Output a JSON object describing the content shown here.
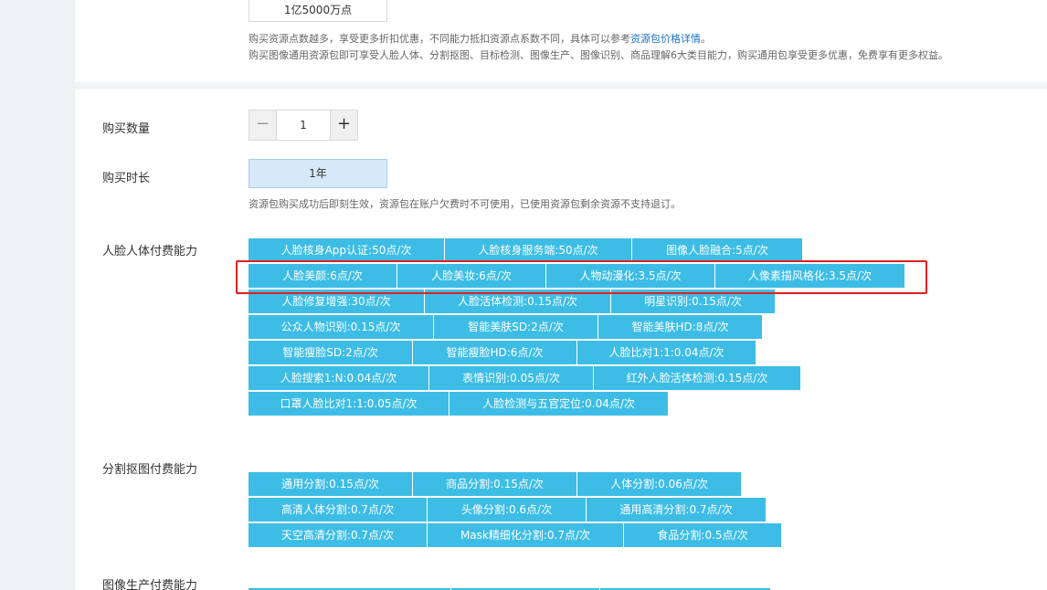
{
  "top": {
    "points_value": "1亿5000万点",
    "note_line1_before": "购买资源点数越多，享受更多折扣优惠，不同能力抵扣资源点系数不同，具体可以参考",
    "note_line1_link": "资源包价格详情",
    "note_line1_after": "。",
    "note_line2": "购买图像通用资源包即可享受人脸人体、分割抠图、目标检测、图像生产、图像识别、商品理解6大类目能力，购买通用包享受更多优惠，免费享有更多权益。"
  },
  "quantity": {
    "label": "购买数量",
    "minus": "−",
    "value": "1",
    "plus": "+"
  },
  "duration": {
    "label": "购买时长",
    "value": "1年",
    "note": "资源包购买成功后即刻生效，资源包在账户欠费时不可使用，已使用资源包剩余资源不支持退订。"
  },
  "face_section": {
    "label": "人脸人体付费能力",
    "tags": [
      "人脸核身App认证:50点/次",
      "人脸核身服务端:50点/次",
      "图像人脸融合:5点/次",
      "人脸美颜:6点/次",
      "人脸美妆:6点/次",
      "人物动漫化:3.5点/次",
      "人像素描风格化:3.5点/次",
      "人脸修复增强:30点/次",
      "人脸活体检测:0.15点/次",
      "明星识别:0.15点/次",
      "公众人物识别:0.15点/次",
      "智能美肤SD:2点/次",
      "智能美肤HD:8点/次",
      "智能瘦脸SD:2点/次",
      "智能瘦脸HD:6点/次",
      "人脸比对1:1:0.04点/次",
      "人脸搜索1:N:0.04点/次",
      "表情识别:0.05点/次",
      "红外人脸活体检测:0.15点/次",
      "口罩人脸比对1:1:0.05点/次",
      "人脸检测与五官定位:0.04点/次"
    ]
  },
  "seg_section": {
    "label": "分割抠图付费能力",
    "tags": [
      "通用分割:0.15点/次",
      "商品分割:0.15点/次",
      "人体分割:0.06点/次",
      "高清人体分割:0.7点/次",
      "头像分割:0.6点/次",
      "通用高清分割:0.7点/次",
      "天空高清分割:0.7点/次",
      "Mask精细化分割:0.7点/次",
      "食品分割:0.5点/次"
    ]
  },
  "gen_section": {
    "label": "图像生产付费能力"
  },
  "colors": {
    "tag_bg": "#3dbde5",
    "highlight": "#e02020",
    "link": "#1a73c8"
  }
}
